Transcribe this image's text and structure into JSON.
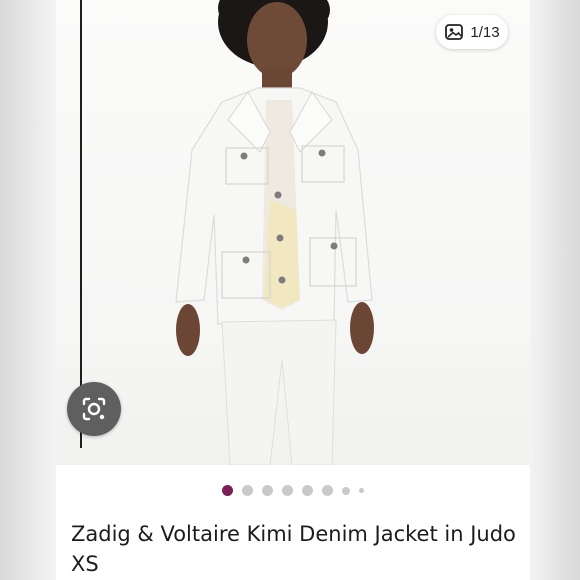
{
  "image_counter": {
    "label": "1/13"
  },
  "carousel": {
    "active_color": "#7b1f56",
    "inactive_color": "#c9c9c9",
    "dots": [
      {
        "active": true,
        "size": "large"
      },
      {
        "active": false,
        "size": "large"
      },
      {
        "active": false,
        "size": "large"
      },
      {
        "active": false,
        "size": "large"
      },
      {
        "active": false,
        "size": "large"
      },
      {
        "active": false,
        "size": "large"
      },
      {
        "active": false,
        "size": "medium"
      },
      {
        "active": false,
        "size": "small"
      }
    ]
  },
  "listing": {
    "title": "Zadig & Voltaire Kimi Denim Jacket in Judo XS"
  },
  "icons": {
    "image_counter": "image-gallery-icon",
    "visual_search": "camera-lens-search-icon"
  }
}
